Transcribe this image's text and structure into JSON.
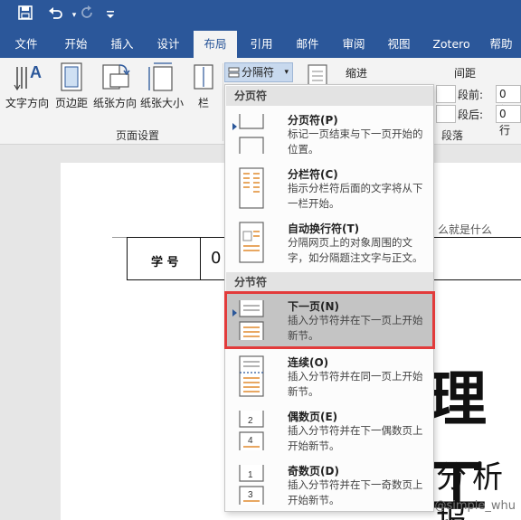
{
  "quick_access": {
    "save_label": "保存",
    "undo_label": "撤消",
    "redo_label": "恢复",
    "customize_label": "自定义"
  },
  "tabs": [
    "文件",
    "开始",
    "插入",
    "设计",
    "布局",
    "引用",
    "邮件",
    "审阅",
    "视图",
    "Zotero",
    "帮助"
  ],
  "ribbon": {
    "text_direction": "文字方向",
    "margins": "页边距",
    "orientation": "纸张方向",
    "size": "纸张大小",
    "columns": "栏",
    "page_setup_group": "页面设置",
    "breaks_button": "分隔符",
    "indent_label": "缩进",
    "spacing_label": "间距",
    "before_label": "段前:",
    "after_label": "段后:",
    "before_value": "0 行",
    "after_value": "0 行",
    "paragraph_group": "段落"
  },
  "dropdown": {
    "page_breaks_header": "分页符",
    "section_breaks_header": "分节符",
    "items": [
      {
        "title": "分页符(P)",
        "desc": "标记一页结束与下一页开始的位置。"
      },
      {
        "title": "分栏符(C)",
        "desc": "指示分栏符后面的文字将从下一栏开始。"
      },
      {
        "title": "自动换行符(T)",
        "desc": "分隔网页上的对象周围的文字，如分隔题注文字与正文。"
      },
      {
        "title": "下一页(N)",
        "desc": "插入分节符并在下一页上开始新节。"
      },
      {
        "title": "连续(O)",
        "desc": "插入分节符并在同一页上开始新节。"
      },
      {
        "title": "偶数页(E)",
        "desc": "插入分节符并在下一偶数页上开始新节。"
      },
      {
        "title": "奇数页(D)",
        "desc": "插入分节符并在下一奇数页上开始新节。"
      }
    ]
  },
  "document": {
    "text_fragment": "么就是什么",
    "table_label": "学 号",
    "table_value": "0",
    "big_title": "理工",
    "sub_title": "分析报",
    "watermark": "CSDN @simple_whu"
  },
  "colors": {
    "brand": "#2b579a",
    "highlight_border": "#e23b3b"
  }
}
